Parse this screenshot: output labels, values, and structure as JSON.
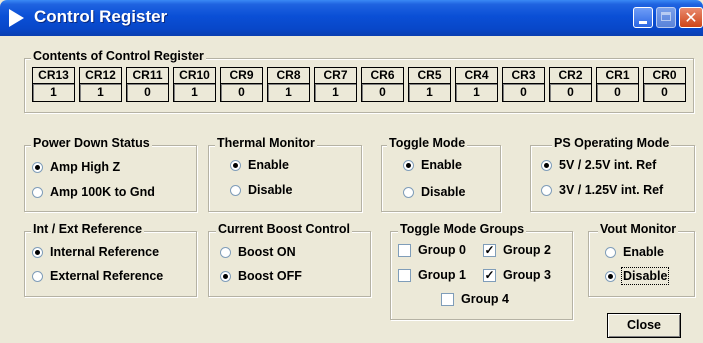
{
  "window": {
    "title": "Control Register",
    "colors": {
      "titlebar": "#0a4fd6",
      "face": "#ece9d8"
    }
  },
  "title_buttons": [
    "minimize-icon",
    "maximize-icon",
    "close-icon"
  ],
  "register": {
    "legend": "Contents of Control Register",
    "bits": [
      {
        "label": "CR13",
        "value": "1"
      },
      {
        "label": "CR12",
        "value": "1"
      },
      {
        "label": "CR11",
        "value": "0"
      },
      {
        "label": "CR10",
        "value": "1"
      },
      {
        "label": "CR9",
        "value": "0"
      },
      {
        "label": "CR8",
        "value": "1"
      },
      {
        "label": "CR7",
        "value": "1"
      },
      {
        "label": "CR6",
        "value": "0"
      },
      {
        "label": "CR5",
        "value": "1"
      },
      {
        "label": "CR4",
        "value": "1"
      },
      {
        "label": "CR3",
        "value": "0"
      },
      {
        "label": "CR2",
        "value": "0"
      },
      {
        "label": "CR1",
        "value": "0"
      },
      {
        "label": "CR0",
        "value": "0"
      }
    ]
  },
  "power_down": {
    "legend": "Power Down Status",
    "options": [
      "Amp High Z",
      "Amp 100K to Gnd"
    ],
    "selected": 0
  },
  "thermal": {
    "legend": "Thermal Monitor",
    "options": [
      "Enable",
      "Disable"
    ],
    "selected": 0
  },
  "toggle_mode": {
    "legend": "Toggle Mode",
    "options": [
      "Enable",
      "Disable"
    ],
    "selected": 0
  },
  "ps_mode": {
    "legend": "PS Operating Mode",
    "options": [
      "5V / 2.5V  int. Ref",
      "3V / 1.25V int. Ref"
    ],
    "selected": 0
  },
  "reference": {
    "legend": "Int / Ext Reference",
    "options": [
      "Internal Reference",
      "External Reference"
    ],
    "selected": 0
  },
  "boost": {
    "legend": "Current Boost Control",
    "options": [
      "Boost ON",
      "Boost OFF"
    ],
    "selected": 1
  },
  "toggle_groups": {
    "legend": "Toggle Mode Groups",
    "groups": [
      {
        "label": "Group 0",
        "checked": false
      },
      {
        "label": "Group 2",
        "checked": true
      },
      {
        "label": "Group 1",
        "checked": false
      },
      {
        "label": "Group 3",
        "checked": true
      },
      {
        "label": "Group 4",
        "checked": false
      }
    ]
  },
  "vout": {
    "legend": "Vout Monitor",
    "options": [
      "Enable",
      "Disable"
    ],
    "selected": 1
  },
  "close_button": "Close"
}
